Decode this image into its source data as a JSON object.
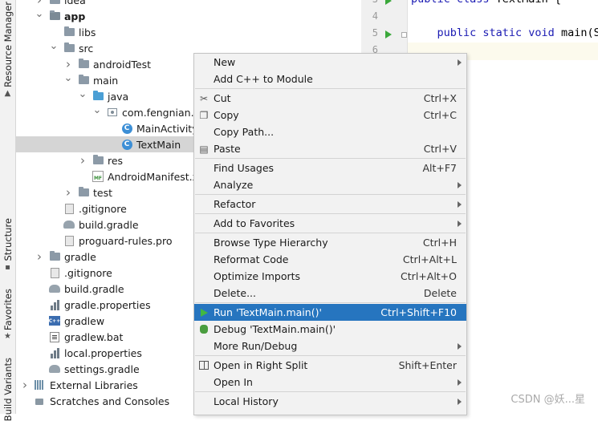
{
  "toolstrip": {
    "resource_manager": "Resource Manager",
    "structure": "Structure",
    "favorites": "Favorites",
    "build_variants": "Build Variants"
  },
  "tree": [
    {
      "label": "idea",
      "icon": "folder-icon",
      "depth": 1,
      "arrow": "right"
    },
    {
      "label": "app",
      "icon": "module-folder-icon",
      "depth": 1,
      "arrow": "down",
      "bold": true
    },
    {
      "label": "libs",
      "icon": "folder-icon",
      "depth": 2,
      "arrow": ""
    },
    {
      "label": "src",
      "icon": "folder-icon",
      "depth": 2,
      "arrow": "down"
    },
    {
      "label": "androidTest",
      "icon": "folder-icon",
      "depth": 3,
      "arrow": "right"
    },
    {
      "label": "main",
      "icon": "folder-icon",
      "depth": 3,
      "arrow": "down"
    },
    {
      "label": "java",
      "icon": "source-folder-icon",
      "depth": 4,
      "arrow": "down"
    },
    {
      "label": "com.fengnian.m",
      "icon": "package-icon",
      "depth": 5,
      "arrow": "down"
    },
    {
      "label": "MainActivity",
      "icon": "class-icon",
      "depth": 6,
      "arrow": ""
    },
    {
      "label": "TextMain",
      "icon": "class-icon",
      "depth": 6,
      "arrow": "",
      "selected": true
    },
    {
      "label": "res",
      "icon": "resource-folder-icon",
      "depth": 4,
      "arrow": "right"
    },
    {
      "label": "AndroidManifest.x",
      "icon": "manifest-icon",
      "depth": 4,
      "arrow": ""
    },
    {
      "label": "test",
      "icon": "folder-icon",
      "depth": 3,
      "arrow": "right"
    },
    {
      "label": ".gitignore",
      "icon": "gitignore-icon",
      "depth": 2,
      "arrow": ""
    },
    {
      "label": "build.gradle",
      "icon": "gradle-icon",
      "depth": 2,
      "arrow": ""
    },
    {
      "label": "proguard-rules.pro",
      "icon": "file-icon",
      "depth": 2,
      "arrow": ""
    },
    {
      "label": "gradle",
      "icon": "folder-icon",
      "depth": 1,
      "arrow": "right"
    },
    {
      "label": ".gitignore",
      "icon": "gitignore-icon",
      "depth": 1,
      "arrow": ""
    },
    {
      "label": "build.gradle",
      "icon": "gradle-icon",
      "depth": 1,
      "arrow": ""
    },
    {
      "label": "gradle.properties",
      "icon": "properties-icon",
      "depth": 1,
      "arrow": ""
    },
    {
      "label": "gradlew",
      "icon": "gradlew-icon",
      "depth": 1,
      "arrow": ""
    },
    {
      "label": "gradlew.bat",
      "icon": "bat-file-icon",
      "depth": 1,
      "arrow": ""
    },
    {
      "label": "local.properties",
      "icon": "properties-icon",
      "depth": 1,
      "arrow": ""
    },
    {
      "label": "settings.gradle",
      "icon": "gradle-icon",
      "depth": 1,
      "arrow": ""
    },
    {
      "label": "External Libraries",
      "icon": "libraries-icon",
      "depth": 0,
      "arrow": "right"
    },
    {
      "label": "Scratches and Consoles",
      "icon": "scratches-icon",
      "depth": 0,
      "arrow": ""
    }
  ],
  "editor": {
    "lines": [
      {
        "num": "3",
        "run": true,
        "tokens": [
          {
            "t": "public class ",
            "kw": true
          },
          {
            "t": "TextMain {",
            "kw": false
          }
        ]
      },
      {
        "num": "4",
        "run": false,
        "tokens": []
      },
      {
        "num": "5",
        "run": true,
        "tokens": [
          {
            "t": "    public static void ",
            "kw": true
          },
          {
            "t": "main(S",
            "kw": false
          }
        ]
      },
      {
        "num": "6",
        "run": false,
        "tokens": []
      }
    ],
    "watermark": "CSDN @妖...星"
  },
  "context_menu": {
    "items": [
      {
        "type": "item",
        "label": "New",
        "submenu": true
      },
      {
        "type": "item",
        "label": "Add C++ to Module"
      },
      {
        "type": "sep"
      },
      {
        "type": "item",
        "label": "Cut",
        "shortcut": "Ctrl+X",
        "icon": "cut-icon"
      },
      {
        "type": "item",
        "label": "Copy",
        "shortcut": "Ctrl+C",
        "icon": "copy-icon"
      },
      {
        "type": "item",
        "label": "Copy Path..."
      },
      {
        "type": "item",
        "label": "Paste",
        "shortcut": "Ctrl+V",
        "icon": "paste-icon"
      },
      {
        "type": "sep"
      },
      {
        "type": "item",
        "label": "Find Usages",
        "shortcut": "Alt+F7"
      },
      {
        "type": "item",
        "label": "Analyze",
        "submenu": true
      },
      {
        "type": "sep"
      },
      {
        "type": "item",
        "label": "Refactor",
        "submenu": true
      },
      {
        "type": "sep"
      },
      {
        "type": "item",
        "label": "Add to Favorites",
        "submenu": true
      },
      {
        "type": "sep"
      },
      {
        "type": "item",
        "label": "Browse Type Hierarchy",
        "shortcut": "Ctrl+H"
      },
      {
        "type": "item",
        "label": "Reformat Code",
        "shortcut": "Ctrl+Alt+L"
      },
      {
        "type": "item",
        "label": "Optimize Imports",
        "shortcut": "Ctrl+Alt+O"
      },
      {
        "type": "item",
        "label": "Delete...",
        "shortcut": "Delete"
      },
      {
        "type": "sep"
      },
      {
        "type": "item",
        "label": "Run 'TextMain.main()'",
        "shortcut": "Ctrl+Shift+F10",
        "icon": "run-icon",
        "highlighted": true
      },
      {
        "type": "item",
        "label": "Debug 'TextMain.main()'",
        "icon": "debug-icon"
      },
      {
        "type": "item",
        "label": "More Run/Debug",
        "submenu": true
      },
      {
        "type": "sep"
      },
      {
        "type": "item",
        "label": "Open in Right Split",
        "shortcut": "Shift+Enter",
        "icon": "split-icon"
      },
      {
        "type": "item",
        "label": "Open In",
        "submenu": true
      },
      {
        "type": "sep"
      },
      {
        "type": "item",
        "label": "Local History",
        "submenu": true
      }
    ]
  }
}
